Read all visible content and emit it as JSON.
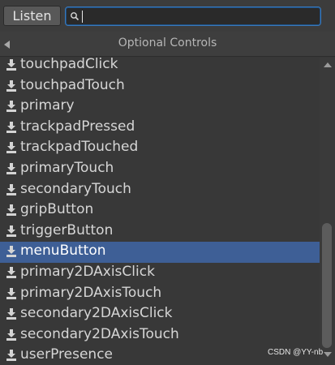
{
  "toolbar": {
    "listen_label": "Listen",
    "search_value": ""
  },
  "header": {
    "title": "Optional Controls"
  },
  "list": {
    "items": [
      {
        "label": "touchpadClick",
        "icon": "download-icon"
      },
      {
        "label": "touchpadTouch",
        "icon": "download-icon"
      },
      {
        "label": "primary",
        "icon": "download-icon"
      },
      {
        "label": "trackpadPressed",
        "icon": "download-icon"
      },
      {
        "label": "trackpadTouched",
        "icon": "download-icon"
      },
      {
        "label": "primaryTouch",
        "icon": "download-icon"
      },
      {
        "label": "secondaryTouch",
        "icon": "download-icon"
      },
      {
        "label": "gripButton",
        "icon": "download-icon"
      },
      {
        "label": "triggerButton",
        "icon": "download-icon"
      },
      {
        "label": "menuButton",
        "icon": "download-icon",
        "selected": true
      },
      {
        "label": "primary2DAxisClick",
        "icon": "download-icon"
      },
      {
        "label": "primary2DAxisTouch",
        "icon": "download-icon"
      },
      {
        "label": "secondary2DAxisClick",
        "icon": "download-icon"
      },
      {
        "label": "secondary2DAxisTouch",
        "icon": "download-icon"
      },
      {
        "label": "userPresence",
        "icon": "download-icon"
      }
    ]
  },
  "colors": {
    "selection": "#3e5f96",
    "search_focus": "#3a79bb"
  },
  "watermark": "CSDN @YY-nb"
}
